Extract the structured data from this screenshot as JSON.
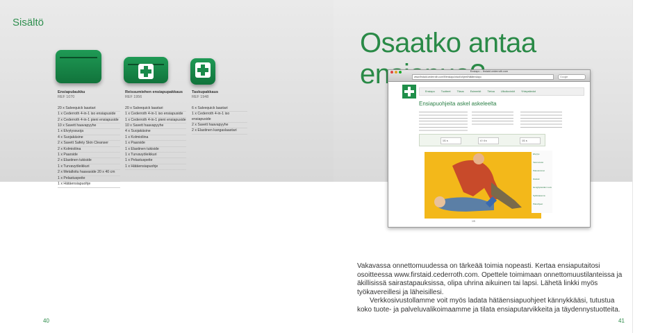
{
  "section": "Sisältö",
  "headline": "Osaatko antaa ensiapua?",
  "kits": [
    {
      "title": "Ensiapulaukku",
      "ref": "REF 1070",
      "items": [
        "20 x Salvequick laastari",
        "1 x Cederroth 4-in-1 iso ensiapuside",
        "2 x Cederroth 4-in-1 pieni ensiapuside",
        "10 x Savett haavapyyhe",
        "1 x Elvytyssuoja",
        "4 x Suojakäsine",
        "2 x Savett Safety Skin Cleanser",
        "2 x Kolmioliina",
        "1 x Paarside",
        "2 x Elastinen tukiside",
        "1 x Turvavyöleikkuri",
        "2 x Metalloitu haavaside 20 x 40 cm",
        "1 x Pelastuspeite",
        "1 x Hätäensiapuohje"
      ]
    },
    {
      "title": "Reissumiehen ensiapupakkaus",
      "ref": "REF 1956",
      "items": [
        "20 x Salvequick laastari",
        "1 x Cederroth 4-in-1 iso ensiapuside",
        "1 x Cederroth 4-in-1 pieni ensiapuside",
        "10 x Savett haavapyyhe",
        "4 x Suojakäsine",
        "1 x Kolmioliina",
        "1 x Paarside",
        "1 x Elastinen tukiside",
        "1 x Turvavyöleikkuri",
        "1 x Pelastuspeite",
        "1 x Hätäensiapuohje"
      ]
    },
    {
      "title": "Taskupakkaus",
      "ref": "REF 1948",
      "items": [
        "6 x Salvequick laastari",
        "1 x Cederroth 4-in-1 iso ensiapuside",
        "2 x Savett haavapyyhe",
        "2 x Elastinen kangaslaastari"
      ]
    }
  ],
  "browser": {
    "window_title": "Ensiapu – firstaid.cederroth.com",
    "url": "www.firstaid.cederroth.com/fi/ensiapu/sivut/ohjeet/hätäensiapu",
    "search_placeholder": "Google",
    "nav": [
      "Ensiapu",
      "Tuotteet",
      "Tilaus",
      "Esimerkit",
      "Tietoa",
      "Ulkoiluvinkit",
      "Yhteystiedot"
    ],
    "page_heading": "Ensiapuohjeita askel askeleelta",
    "steps": [
      "1/1 s",
      "4 / 4 s",
      "1/1 s"
    ],
    "sidebar": [
      "Elvytys",
      "Verenvuoto",
      "Palovammat",
      "Haavat",
      "Hengitysteiden Luvu",
      "Sydänasema",
      "Paloohjeet"
    ],
    "pager": "1/5"
  },
  "body": {
    "p1": "Vakavassa onnettomuudessa on tärkeää toimia nopeasti. Kertaa ensiaputaitosi osoitteessa www.firstaid.cederroth.com. Opettele toimimaan onnettomuustilanteissa ja äkillisissä sairastapauksissa, olipa uhrina aikuinen tai lapsi. Lähetä linkki myös työkavereillesi ja läheisillesi.",
    "p2": "Verkkosivustollamme voit myös ladata hätäensiapuohjeet kännykkääsi, tutustua koko tuote- ja palveluvalikoimaamme ja tilata ensiaputarvikkeita ja täydennystuotteita."
  },
  "page_left": "40",
  "page_right": "41"
}
